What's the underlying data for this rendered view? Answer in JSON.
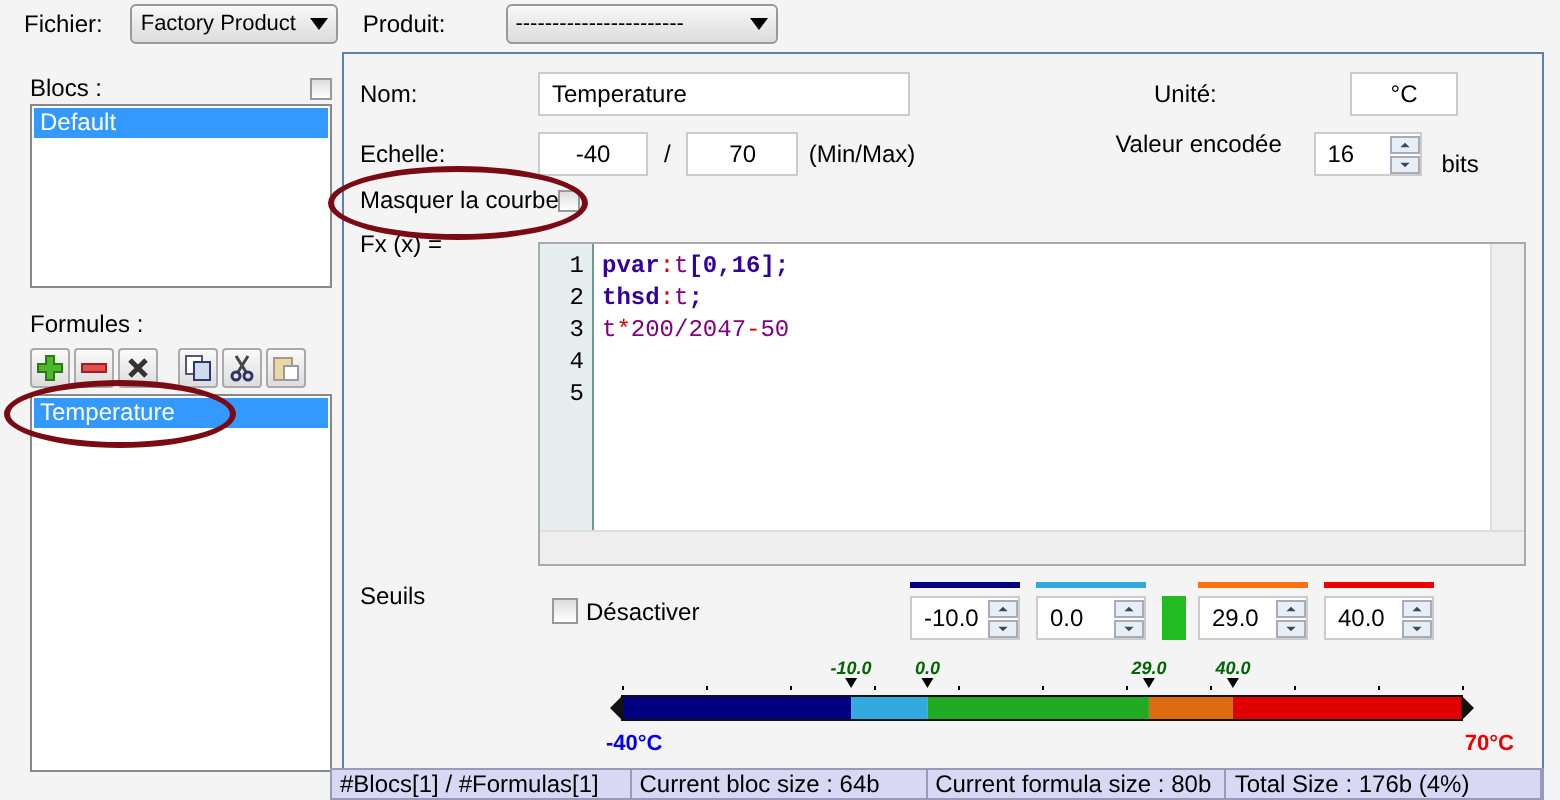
{
  "top_bar": {
    "file_label": "Fichier:",
    "file_value": "Factory Product",
    "product_label": "Produit:",
    "product_value": "-----------------------"
  },
  "blocks": {
    "label": "Blocs :",
    "checked": false,
    "items": [
      {
        "label": "Default",
        "selected": true
      }
    ]
  },
  "formulas": {
    "label": "Formules :",
    "items": [
      {
        "label": "Temperature",
        "selected": true,
        "highlighted": true
      }
    ]
  },
  "form": {
    "name_label": "Nom:",
    "name_value": "Temperature",
    "unit_label": "Unité:",
    "unit_value": "°C",
    "scale_label": "Echelle:",
    "scale_min": "-40",
    "scale_sep": "/",
    "scale_max": "70",
    "scale_hint": "(Min/Max)",
    "encoded_label": "Valeur encodée",
    "encoded_value": "16",
    "encoded_unit": "bits",
    "hide_curve_label": "Masquer la courbe",
    "hide_curve_checked": false,
    "hide_curve_highlighted": true,
    "fx_label": "Fx (x) ="
  },
  "editor": {
    "lines": [
      {
        "number": "1",
        "tokens": [
          {
            "kind": "kw",
            "text": "pvar"
          },
          {
            "kind": "op",
            "text": ":"
          },
          {
            "kind": "var",
            "text": "t"
          },
          {
            "kind": "kw",
            "text": "[0,16];"
          }
        ]
      },
      {
        "number": "2",
        "tokens": [
          {
            "kind": "kw",
            "text": "thsd"
          },
          {
            "kind": "op",
            "text": ":"
          },
          {
            "kind": "var",
            "text": "t"
          },
          {
            "kind": "kw",
            "text": ";"
          }
        ]
      },
      {
        "number": "3",
        "tokens": [
          {
            "kind": "var",
            "text": "t"
          },
          {
            "kind": "op",
            "text": "*"
          },
          {
            "kind": "num",
            "text": "200/2047"
          },
          {
            "kind": "op",
            "text": "-"
          },
          {
            "kind": "num",
            "text": "50"
          }
        ]
      },
      {
        "number": "4"
      },
      {
        "number": "5"
      }
    ]
  },
  "thresholds": {
    "label": "Seuils",
    "disable_label": "Désactiver",
    "disabled": false,
    "fields": [
      {
        "value": "-10.0",
        "color": "#000080"
      },
      {
        "value": "0.0",
        "color": "#33aadd"
      },
      {
        "value": "29.0",
        "color": "#ff7010"
      },
      {
        "value": "40.0",
        "color": "#ee0000"
      }
    ],
    "middle": {
      "color": "#22bb22"
    },
    "scale": {
      "min_label": "-40°C",
      "max_label": "70°C",
      "markers": [
        "-10.0",
        "0.0",
        "29.0",
        "40.0"
      ],
      "bands": [
        {
          "color": "#000080"
        },
        {
          "color": "#33aadd"
        },
        {
          "color": "#22aa22"
        },
        {
          "color": "#e06a10"
        },
        {
          "color": "#e00000"
        }
      ]
    }
  },
  "status_bar": [
    "#Blocs[1] / #Formulas[1]",
    "Current bloc size : 64b",
    "Current formula size : 80b",
    "Total Size : 176b (4%)"
  ]
}
